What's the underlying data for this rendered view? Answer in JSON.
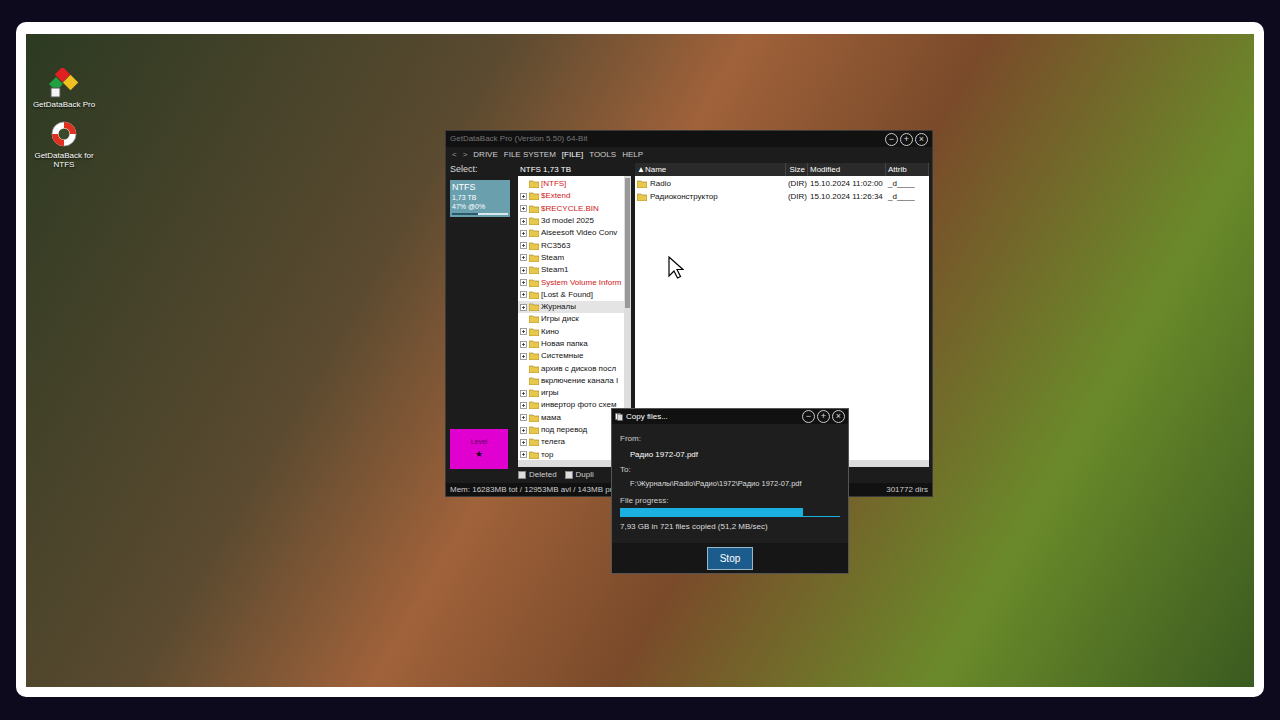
{
  "desktop": {
    "icons": [
      {
        "label": "GetDataBack Pro",
        "kind": "pro"
      },
      {
        "label": "GetDataBack for NTFS",
        "kind": "ntfs"
      }
    ]
  },
  "main_window": {
    "title": "GetDataBack Pro (Version 5.50) 64-Bit",
    "window_buttons": [
      "−",
      "+",
      "×"
    ],
    "nav": [
      "<",
      ">"
    ],
    "menu": [
      {
        "label": "DRIVE",
        "selected": false
      },
      {
        "label": "FILE SYSTEM",
        "selected": false
      },
      {
        "label": "[FILE]",
        "selected": true
      },
      {
        "label": "TOOLS",
        "selected": false
      },
      {
        "label": "HELP",
        "selected": false
      }
    ],
    "select_label": "Select:",
    "drive_tile": {
      "name": "NTFS",
      "size": "1,73 TB",
      "usage": "47% @0%",
      "selected": true,
      "level": 0.47
    },
    "level_box": {
      "label": "Level",
      "value": "★"
    },
    "tree": {
      "header": "NTFS 1,73 TB",
      "items": [
        {
          "label": "[NTFS]",
          "expandable": false,
          "selected": false,
          "color": "#d02020"
        },
        {
          "label": "$Extend",
          "expandable": true,
          "selected": false,
          "color": "#d02020"
        },
        {
          "label": "$RECYCLE.BIN",
          "expandable": true,
          "selected": false,
          "color": "#d02020"
        },
        {
          "label": "3d model 2025",
          "expandable": true,
          "selected": false,
          "color": "#111111"
        },
        {
          "label": "Aiseesoft Video Conv",
          "expandable": true,
          "selected": false,
          "color": "#111111"
        },
        {
          "label": "RC3563",
          "expandable": true,
          "selected": false,
          "color": "#111111"
        },
        {
          "label": "Steam",
          "expandable": true,
          "selected": false,
          "color": "#111111"
        },
        {
          "label": "Steam1",
          "expandable": true,
          "selected": false,
          "color": "#111111"
        },
        {
          "label": "System Volume Inform",
          "expandable": true,
          "selected": false,
          "color": "#d02020"
        },
        {
          "label": "[Lost & Found]",
          "expandable": true,
          "selected": false,
          "color": "#111111"
        },
        {
          "label": "Журналы",
          "expandable": true,
          "selected": true,
          "color": "#111111"
        },
        {
          "label": "Игры диск",
          "expandable": false,
          "selected": false,
          "color": "#111111"
        },
        {
          "label": "Кино",
          "expandable": true,
          "selected": false,
          "color": "#111111"
        },
        {
          "label": "Новая папка",
          "expandable": true,
          "selected": false,
          "color": "#111111"
        },
        {
          "label": "Системные",
          "expandable": true,
          "selected": false,
          "color": "#111111"
        },
        {
          "label": "архив с дисков посл",
          "expandable": false,
          "selected": false,
          "color": "#111111"
        },
        {
          "label": "вкрлючение канала I",
          "expandable": false,
          "selected": false,
          "color": "#111111"
        },
        {
          "label": "игры",
          "expandable": true,
          "selected": false,
          "color": "#111111"
        },
        {
          "label": "инвертор фото схем",
          "expandable": true,
          "selected": false,
          "color": "#111111"
        },
        {
          "label": "мама",
          "expandable": true,
          "selected": false,
          "color": "#111111"
        },
        {
          "label": "под перевод",
          "expandable": true,
          "selected": false,
          "color": "#111111"
        },
        {
          "label": "телега",
          "expandable": true,
          "selected": false,
          "color": "#111111"
        },
        {
          "label": "тор",
          "expandable": true,
          "selected": false,
          "color": "#111111"
        }
      ]
    },
    "list": {
      "columns": [
        "▲Name",
        "Size",
        "Modified",
        "Attrib"
      ],
      "rows": [
        {
          "name": "Radio",
          "size": "(DIR)",
          "modified": "15.10.2024 11:02:00",
          "attrib": "_d____"
        },
        {
          "name": "Радиоконструктор",
          "size": "(DIR)",
          "modified": "15.10.2024 11:26:34",
          "attrib": "_d____"
        }
      ]
    },
    "filters": [
      {
        "label": "Deleted",
        "checked": false
      },
      {
        "label": "Dupli",
        "checked": false
      }
    ],
    "status_bar": {
      "left": "Mem: 16283MB tot / 12953MB avl / 143MB prc",
      "right": "301772 dirs"
    }
  },
  "copy_dialog": {
    "title": "Copy files...",
    "window_buttons": [
      "−",
      "+",
      "×"
    ],
    "from_label": "From:",
    "from": "Радио 1972-07.pdf",
    "to_label": "To:",
    "to": "F:\\Журналы\\Radio\\Радио\\1972\\Радио 1972-07.pdf",
    "progress_label": "File progress:",
    "level": 0.83,
    "summary": "7,93 GB in 721 files copied (51,2 MB/sec)",
    "buttons": [
      "Stop"
    ]
  }
}
